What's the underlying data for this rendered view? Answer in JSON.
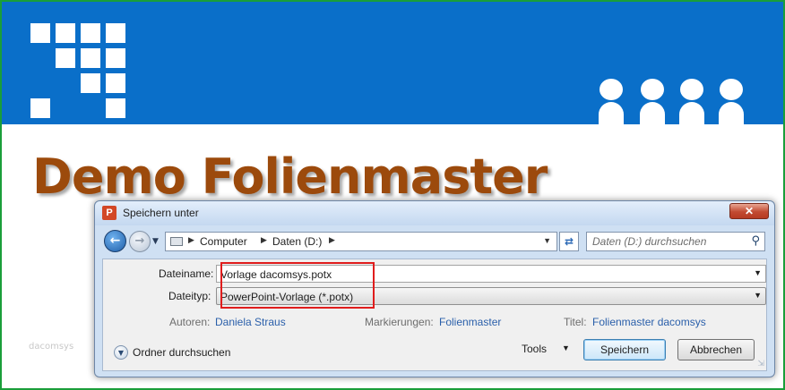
{
  "slide": {
    "title": "Demo Folienmaster",
    "footer_text": "dacomsys"
  },
  "dialog": {
    "title": "Speichern unter",
    "app_icon": "powerpoint-icon",
    "app_icon_letter": "P",
    "close_glyph": "✕",
    "breadcrumb": [
      "Computer",
      "Daten (D:)"
    ],
    "search_placeholder": "Daten (D:) durchsuchen",
    "filename_label": "Dateiname:",
    "filename_value": "Vorlage dacomsys.potx",
    "filetype_label": "Dateityp:",
    "filetype_value": "PowerPoint-Vorlage (*.potx)",
    "authors_label": "Autoren:",
    "authors_value": "Daniela Straus",
    "tags_label": "Markierungen:",
    "tags_value": "Folienmaster",
    "title_label": "Titel:",
    "title_value": "Folienmaster dacomsys",
    "browse_folders_label": "Ordner durchsuchen",
    "tools_label": "Tools",
    "save_label": "Speichern",
    "cancel_label": "Abbrechen"
  },
  "colors": {
    "header_blue": "#0a6fc9",
    "title_brown": "#9c4a0c",
    "highlight_red": "#e01d1d",
    "link_blue": "#2a5faa"
  }
}
